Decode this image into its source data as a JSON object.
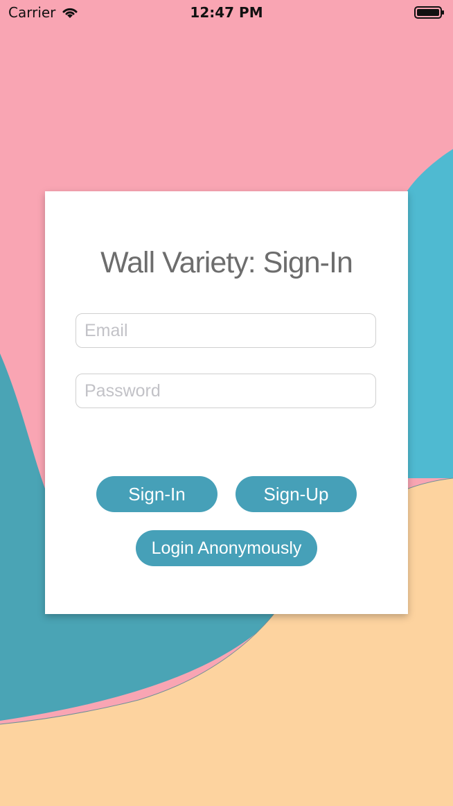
{
  "status_bar": {
    "carrier": "Carrier",
    "time": "12:47 PM",
    "wifi_icon": "wifi-icon",
    "battery_icon": "battery-icon"
  },
  "colors": {
    "pink": "#f9a5b3",
    "teal": "#4aa4b5",
    "light_blue": "#4fbad1",
    "peach": "#fdd39f",
    "button": "#46a0b8",
    "title": "#6d6d6d"
  },
  "login": {
    "title": "Wall Variety: Sign-In",
    "email": {
      "value": "",
      "placeholder": "Email"
    },
    "password": {
      "value": "",
      "placeholder": "Password"
    },
    "signin_label": "Sign-In",
    "signup_label": "Sign-Up",
    "anonymous_label": "Login Anonymously"
  }
}
